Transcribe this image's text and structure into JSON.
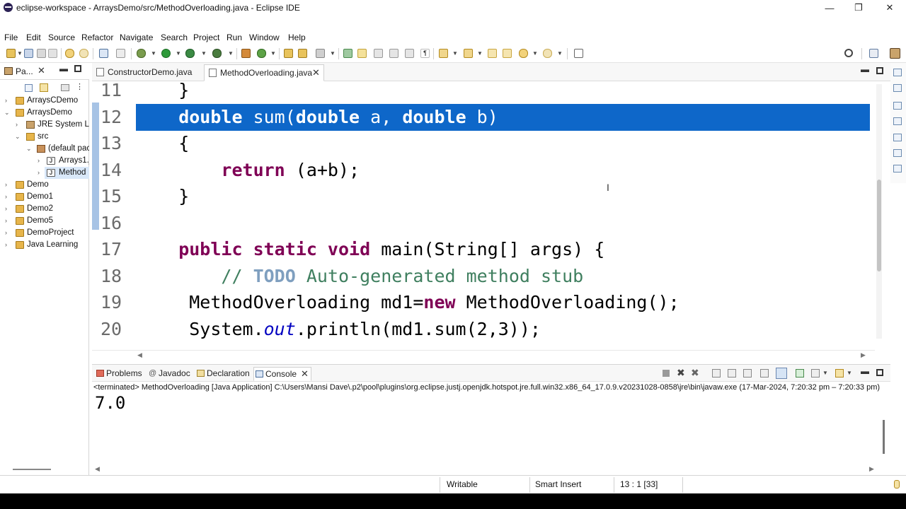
{
  "window": {
    "title": "eclipse-workspace - ArraysDemo/src/MethodOverloading.java - Eclipse IDE",
    "controls": [
      "—",
      "❐",
      "✕"
    ]
  },
  "menu": [
    "File",
    "Edit",
    "Source",
    "Refactor",
    "Navigate",
    "Search",
    "Project",
    "Run",
    "Window",
    "Help"
  ],
  "package_explorer": {
    "tab_label": "Pa...",
    "items": [
      {
        "label": "ArraysCDemo",
        "icon": "project-icon",
        "expanded": false
      },
      {
        "label": "ArraysDemo",
        "icon": "project-icon",
        "expanded": true
      },
      {
        "label": "JRE System Lib",
        "icon": "library-icon",
        "expanded": false
      },
      {
        "label": "src",
        "icon": "source-folder-icon",
        "expanded": true
      },
      {
        "label": "(default pac",
        "icon": "package-icon",
        "expanded": true
      },
      {
        "label": "Arrays1.j",
        "icon": "java-file-icon",
        "expanded": false
      },
      {
        "label": "Method",
        "icon": "java-file-icon",
        "expanded": false,
        "selected": true
      },
      {
        "label": "Demo",
        "icon": "project-icon",
        "expanded": false
      },
      {
        "label": "Demo1",
        "icon": "project-icon",
        "expanded": false
      },
      {
        "label": "Demo2",
        "icon": "project-icon",
        "expanded": false
      },
      {
        "label": "Demo5",
        "icon": "project-icon",
        "expanded": false
      },
      {
        "label": "DemoProject",
        "icon": "project-icon",
        "expanded": false
      },
      {
        "label": "Java Learning",
        "icon": "project-icon",
        "expanded": false
      }
    ]
  },
  "editor": {
    "tabs": [
      {
        "label": "ConstructorDemo.java",
        "active": false
      },
      {
        "label": "MethodOverloading.java",
        "active": true
      }
    ],
    "lines": [
      {
        "n": "11",
        "parts": [
          [
            "",
            "    }"
          ]
        ]
      },
      {
        "n": "12",
        "highlight": true,
        "parts": [
          [
            "sel-kw",
            "    double"
          ],
          [
            "sel-tx",
            " sum("
          ],
          [
            "sel-kw",
            "double"
          ],
          [
            "sel-tx",
            " a, "
          ],
          [
            "sel-kw",
            "double"
          ],
          [
            "sel-tx",
            " b)"
          ]
        ]
      },
      {
        "n": "13",
        "parts": [
          [
            "",
            "    {"
          ]
        ]
      },
      {
        "n": "14",
        "parts": [
          [
            "kw",
            "        return"
          ],
          [
            "",
            " (a+b);"
          ]
        ]
      },
      {
        "n": "15",
        "parts": [
          [
            "",
            "    }"
          ]
        ]
      },
      {
        "n": "16",
        "parts": [
          [
            "",
            ""
          ]
        ]
      },
      {
        "n": "17",
        "parts": [
          [
            "kw",
            "    public static void"
          ],
          [
            "",
            " main(String[] args) {"
          ]
        ]
      },
      {
        "n": "18",
        "parts": [
          [
            "cm",
            "        // "
          ],
          [
            "todo",
            "TODO"
          ],
          [
            "cm",
            " Auto-generated method stub"
          ]
        ]
      },
      {
        "n": "19",
        "parts": [
          [
            "",
            "     MethodOverloading md1="
          ],
          [
            "kw",
            "new"
          ],
          [
            "",
            " MethodOverloading();"
          ]
        ]
      },
      {
        "n": "20",
        "parts": [
          [
            "",
            "     System."
          ],
          [
            "fld",
            "out"
          ],
          [
            "",
            ".println(md1.sum(2,3));"
          ]
        ]
      }
    ]
  },
  "console": {
    "tabs": [
      {
        "label": "Problems",
        "active": false
      },
      {
        "label": "Javadoc",
        "active": false
      },
      {
        "label": "Declaration",
        "active": false
      },
      {
        "label": "Console",
        "active": true
      }
    ],
    "status": "<terminated> MethodOverloading [Java Application] C:\\Users\\Mansi Dave\\.p2\\pool\\plugins\\org.eclipse.justj.openjdk.hotspot.jre.full.win32.x86_64_17.0.9.v20231028-0858\\jre\\bin\\javaw.exe  (17-Mar-2024, 7:20:32 pm – 7:20:33 pm)",
    "output": "7.0"
  },
  "statusbar": {
    "mode": "Writable",
    "insert": "Smart Insert",
    "position": "13 : 1 [33]"
  },
  "colors": {
    "selection": "#0e67c9",
    "keyword": "#7f0055",
    "comment": "#3f7f5f",
    "field": "#0000c0"
  }
}
